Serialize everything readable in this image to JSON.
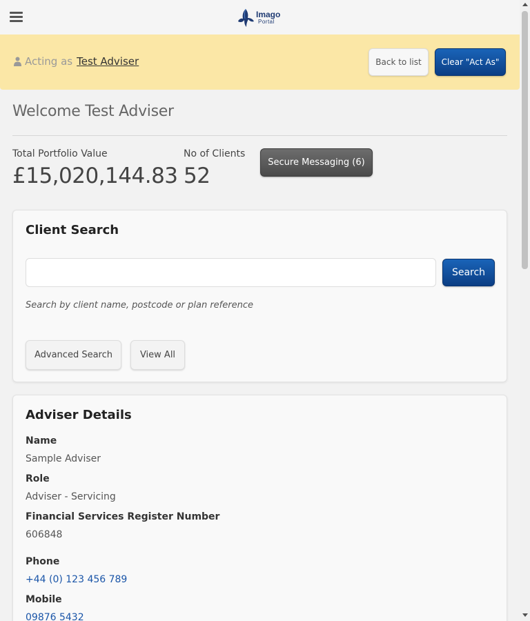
{
  "header": {
    "logo_text": "Imago",
    "logo_sub": "Portal"
  },
  "acting": {
    "label": "Acting as",
    "name": "Test Adviser",
    "back_label": "Back to list",
    "clear_label": "Clear \"Act As\""
  },
  "welcome": "Welcome Test Adviser",
  "stats": {
    "portfolio_label": "Total Portfolio Value",
    "portfolio_value": "£15,020,144.83",
    "clients_label": "No of Clients",
    "clients_value": "52",
    "secure_label": "Secure Messaging (6)"
  },
  "client_search": {
    "title": "Client Search",
    "input_value": "",
    "search_label": "Search",
    "hint": "Search by client name, postcode or plan reference",
    "advanced_label": "Advanced Search",
    "view_all_label": "View All"
  },
  "adviser": {
    "title": "Adviser Details",
    "name_label": "Name",
    "name_value": "Sample Adviser",
    "role_label": "Role",
    "role_value": "Adviser - Servicing",
    "fsr_label": "Financial Services Register Number",
    "fsr_value": "606848",
    "phone_label": "Phone",
    "phone_value": "+44 (0) 123 456 789",
    "mobile_label": "Mobile",
    "mobile_value": "09876 5432"
  },
  "colors": {
    "acting_bar": "#fbe7a6",
    "primary": "#0b3e84",
    "secure": "#4a4a4a",
    "link": "#1a55a8"
  },
  "icons": {
    "menu": "hamburger-menu-icon",
    "logo": "butterfly-logo-icon",
    "acting": "person-icon"
  }
}
